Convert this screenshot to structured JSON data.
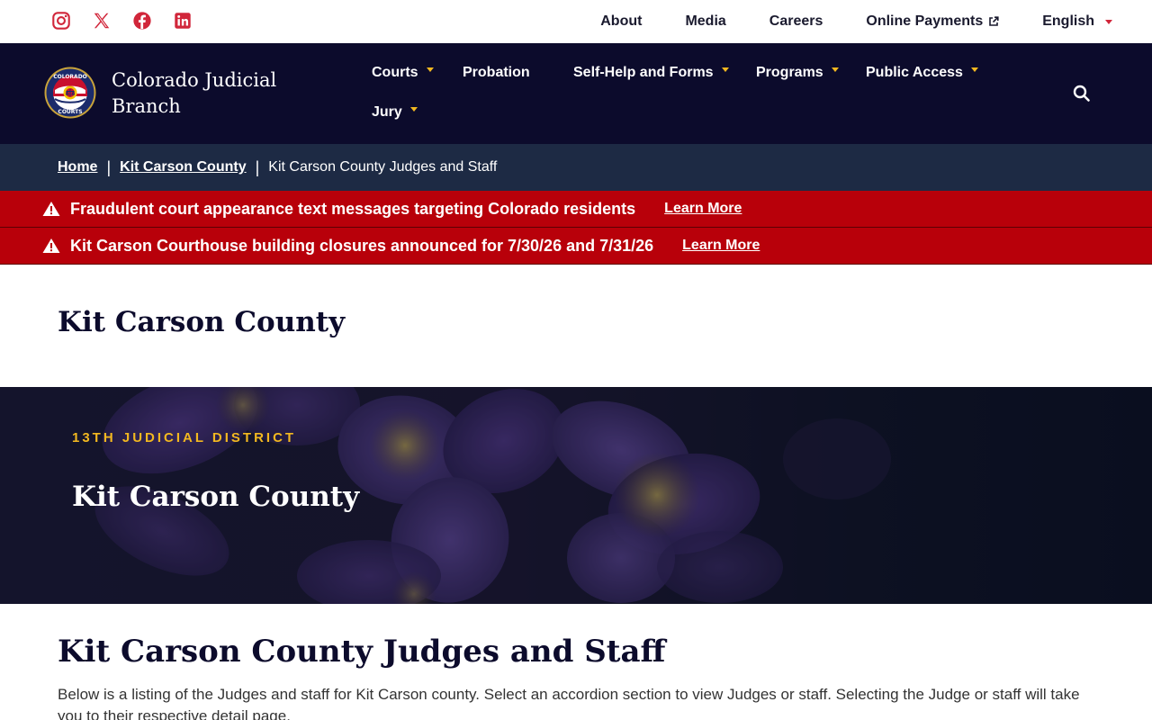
{
  "utility": {
    "social": [
      "instagram-icon",
      "x-icon",
      "facebook-icon",
      "linkedin-icon"
    ],
    "links": {
      "about": "About",
      "media": "Media",
      "careers": "Careers",
      "online_payments": "Online Payments",
      "language": "English"
    }
  },
  "header": {
    "brand": "Colorado Judicial Branch",
    "nav": {
      "courts": "Courts",
      "probation": "Probation",
      "self_help": "Self-Help and Forms",
      "programs": "Programs",
      "public_access": "Public Access",
      "jury": "Jury"
    }
  },
  "breadcrumb": {
    "home": "Home",
    "county": "Kit Carson County",
    "current": "Kit Carson County Judges and Staff"
  },
  "alerts": [
    {
      "message": "Fraudulent court appearance text messages targeting Colorado residents",
      "link": "Learn More"
    },
    {
      "message": "Kit Carson Courthouse building closures announced for 7/30/26 and 7/31/26",
      "link": "Learn More"
    }
  ],
  "page": {
    "title": "Kit Carson County"
  },
  "hero": {
    "eyebrow": "13TH JUDICIAL DISTRICT",
    "title": "Kit Carson County"
  },
  "section": {
    "title": "Kit Carson County Judges and Staff",
    "description": "Below is a listing of the Judges and staff for Kit Carson county. Select an accordion section to view Judges or staff. Selecting the Judge or staff will take you to their respective detail page."
  },
  "colors": {
    "header_bg": "#0c0b2c",
    "breadcrumb_bg": "#1d2a44",
    "alert_bg": "#b8000a",
    "accent_gold": "#f2b820",
    "social_red": "#d1263a"
  }
}
